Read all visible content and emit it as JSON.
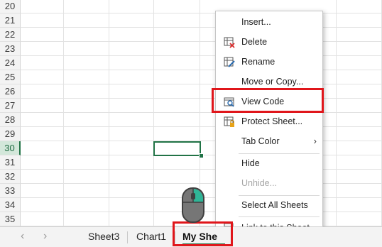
{
  "rows": [
    "20",
    "21",
    "22",
    "23",
    "24",
    "25",
    "26",
    "27",
    "28",
    "29",
    "30",
    "31",
    "32",
    "33",
    "34",
    "35"
  ],
  "active_row": "30",
  "context_menu": {
    "items": [
      {
        "label": "Insert...",
        "icon": "none",
        "enabled": true
      },
      {
        "label": "Delete",
        "icon": "delete-sheet-icon",
        "enabled": true
      },
      {
        "label": "Rename",
        "icon": "rename-sheet-icon",
        "enabled": true
      },
      {
        "label": "Move or Copy...",
        "icon": "none",
        "enabled": true
      },
      {
        "label": "View Code",
        "icon": "view-code-icon",
        "enabled": true,
        "highlighted": true
      },
      {
        "label": "Protect Sheet...",
        "icon": "protect-sheet-icon",
        "enabled": true
      },
      {
        "label": "Tab Color",
        "icon": "none",
        "enabled": true,
        "submenu": "›"
      },
      {
        "label": "Hide",
        "icon": "none",
        "enabled": true
      },
      {
        "label": "Unhide...",
        "icon": "none",
        "enabled": false
      },
      {
        "label": "Select All Sheets",
        "icon": "none",
        "enabled": true
      },
      {
        "label": "Link to this Sheet",
        "icon": "link-icon",
        "enabled": true
      }
    ]
  },
  "tabbar": {
    "nav_prev": "‹",
    "nav_next": "›",
    "tabs": [
      "Sheet3",
      "Chart1",
      "My She"
    ],
    "active_tab": "My She"
  },
  "colors": {
    "excel_green": "#217346",
    "highlight_red": "#e0161b"
  }
}
